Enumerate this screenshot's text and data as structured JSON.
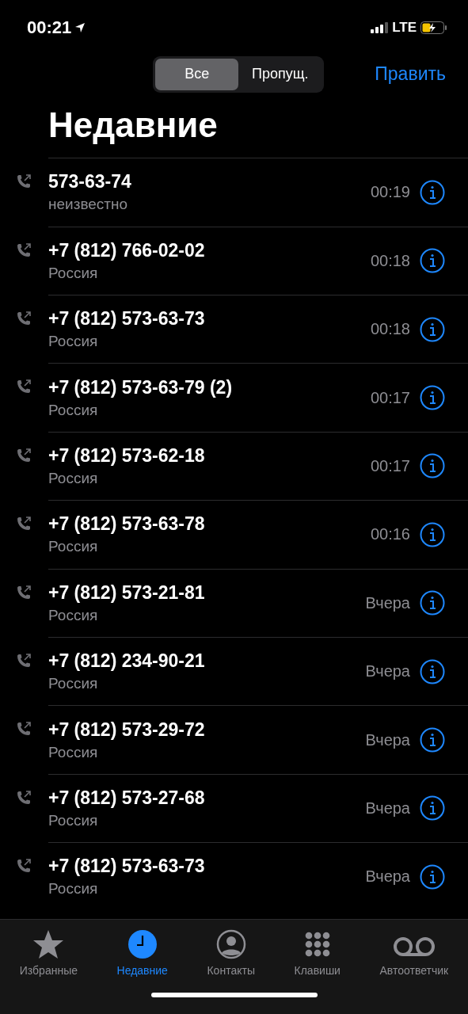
{
  "status_bar": {
    "time": "00:21",
    "network": "LTE"
  },
  "segments": [
    {
      "label": "Все",
      "selected": true
    },
    {
      "label": "Пропущ.",
      "selected": false
    }
  ],
  "edit_button": "Править",
  "title": "Недавние",
  "calls": [
    {
      "number": "573-63-74",
      "subtitle": "неизвестно",
      "time": "00:19"
    },
    {
      "number": "+7 (812) 766-02-02",
      "subtitle": "Россия",
      "time": "00:18"
    },
    {
      "number": "+7 (812) 573-63-73",
      "subtitle": "Россия",
      "time": "00:18"
    },
    {
      "number": "+7 (812) 573-63-79 (2)",
      "subtitle": "Россия",
      "time": "00:17"
    },
    {
      "number": "+7 (812) 573-62-18",
      "subtitle": "Россия",
      "time": "00:17"
    },
    {
      "number": "+7 (812) 573-63-78",
      "subtitle": "Россия",
      "time": "00:16"
    },
    {
      "number": "+7 (812) 573-21-81",
      "subtitle": "Россия",
      "time": "Вчера"
    },
    {
      "number": "+7 (812) 234-90-21",
      "subtitle": "Россия",
      "time": "Вчера"
    },
    {
      "number": "+7 (812) 573-29-72",
      "subtitle": "Россия",
      "time": "Вчера"
    },
    {
      "number": "+7 (812) 573-27-68",
      "subtitle": "Россия",
      "time": "Вчера"
    },
    {
      "number": "+7 (812) 573-63-73",
      "subtitle": "Россия",
      "time": "Вчера"
    }
  ],
  "tab_bar": [
    {
      "label": "Избранные",
      "kind": "star",
      "selected": false
    },
    {
      "label": "Недавние",
      "kind": "clock",
      "selected": true
    },
    {
      "label": "Контакты",
      "kind": "person",
      "selected": false
    },
    {
      "label": "Клавиши",
      "kind": "keypad",
      "selected": false
    },
    {
      "label": "Автоответчик",
      "kind": "voicemail",
      "selected": false
    }
  ]
}
